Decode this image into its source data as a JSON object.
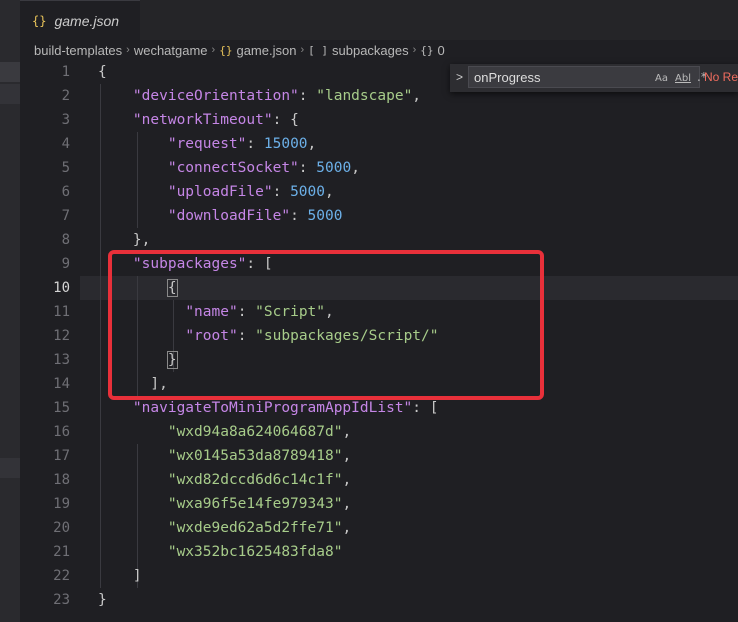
{
  "tab": {
    "icon": "{}",
    "title": "game.json"
  },
  "breadcrumb": {
    "items": [
      "build-templates",
      "wechatgame",
      "game.json",
      "subpackages",
      "0"
    ],
    "icons": [
      "{}",
      "[ ]",
      "{}"
    ]
  },
  "find": {
    "chevron": ">",
    "value": "onProgress",
    "case_label": "Aa",
    "word_label": "Abl",
    "regex_label": ".*",
    "result": "No Re"
  },
  "line_numbers": [
    "1",
    "2",
    "3",
    "4",
    "5",
    "6",
    "7",
    "8",
    "9",
    "10",
    "11",
    "12",
    "13",
    "14",
    "15",
    "16",
    "17",
    "18",
    "19",
    "20",
    "21",
    "22",
    "23"
  ],
  "active_line": "10",
  "code": {
    "l1": "{",
    "l2_key": "\"deviceOrientation\"",
    "l2_val": "\"landscape\"",
    "l3_key": "\"networkTimeout\"",
    "l4_key": "\"request\"",
    "l4_val": "15000",
    "l5_key": "\"connectSocket\"",
    "l5_val": "5000",
    "l6_key": "\"uploadFile\"",
    "l6_val": "5000",
    "l7_key": "\"downloadFile\"",
    "l7_val": "5000",
    "l8": "},",
    "l9_key": "\"subpackages\"",
    "l10": "{",
    "l11_key": "\"name\"",
    "l11_val": "\"Script\"",
    "l12_key": "\"root\"",
    "l12_val": "\"subpackages/Script/\"",
    "l13": "}",
    "l14": "],",
    "l15_key": "\"navigateToMiniProgramAppIdList\"",
    "l16_val": "\"wxd94a8a624064687d\"",
    "l17_val": "\"wx0145a53da8789418\"",
    "l18_val": "\"wxd82dccd6d6c14c1f\"",
    "l19_val": "\"wxa96f5e14fe979343\"",
    "l20_val": "\"wxde9ed62a5d2ffe71\"",
    "l21_val": "\"wx352bc1625483fda8\"",
    "l22": "]",
    "l23": "}"
  },
  "colors": {
    "annotation": "#e8303a",
    "keyword": "#c586e6",
    "string": "#a7cc8a",
    "number": "#6cb0e8"
  }
}
